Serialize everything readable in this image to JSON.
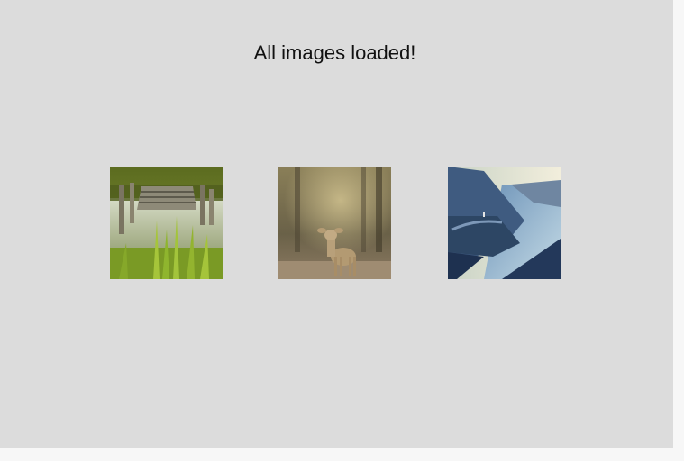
{
  "status": {
    "message": "All images loaded!"
  },
  "gallery": {
    "images": [
      {
        "name": "pier-in-pond-image",
        "colors": [
          "#6f8a2c",
          "#b9c08d",
          "#4a5a1e"
        ]
      },
      {
        "name": "fawn-in-forest-image",
        "colors": [
          "#6b6044",
          "#c9b58a",
          "#8c7c5a"
        ]
      },
      {
        "name": "cliff-over-fjord-image",
        "colors": [
          "#2f4d78",
          "#e9e7cf",
          "#5d7fa8"
        ]
      }
    ]
  }
}
